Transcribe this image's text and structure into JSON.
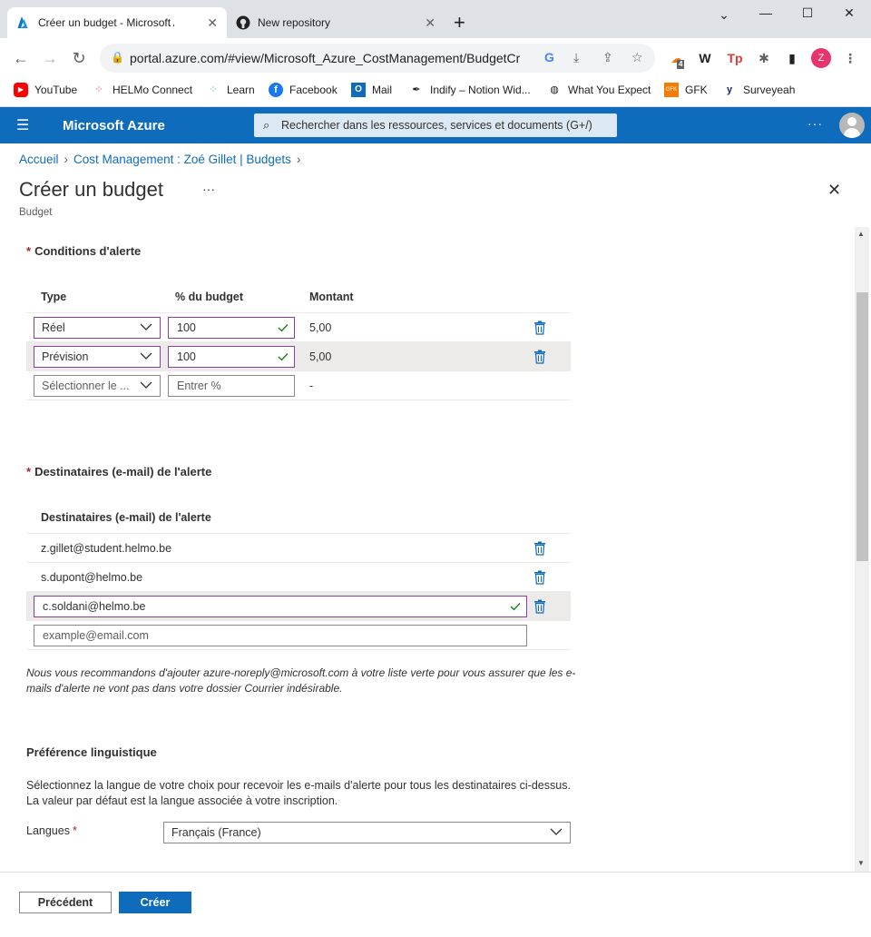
{
  "browser": {
    "tabs": [
      {
        "title": "Créer un budget - Microsoft Azure",
        "active": true
      },
      {
        "title": "New repository",
        "active": false
      }
    ],
    "url": "portal.azure.com/#view/Microsoft_Azure_CostManagement/BudgetCre...",
    "profile_initial": "Z",
    "extension_badge": "4",
    "bookmarks": [
      "YouTube",
      "HELMo Connect",
      "Learn",
      "Facebook",
      "Mail",
      "Indify – Notion Wid...",
      "What You Expect",
      "GFK",
      "Surveyeah"
    ]
  },
  "azure": {
    "brand": "Microsoft Azure",
    "search_placeholder": "Rechercher dans les ressources, services et documents (G+/)",
    "accent": "#0f6cbd"
  },
  "breadcrumb": [
    "Accueil",
    "Cost Management : Zoé Gillet | Budgets"
  ],
  "page": {
    "title": "Créer un budget",
    "subtitle": "Budget"
  },
  "alert_conditions": {
    "title": "Conditions d'alerte",
    "required_mark": "*",
    "columns": [
      "Type",
      "% du budget",
      "Montant"
    ],
    "rows": [
      {
        "type": "Réel",
        "percent": "100",
        "amount": "5,00"
      },
      {
        "type": "Prévision",
        "percent": "100",
        "amount": "5,00"
      }
    ],
    "new_row": {
      "type_placeholder": "Sélectionner le ...",
      "percent_placeholder": "Entrer %",
      "amount": "-"
    }
  },
  "recipients": {
    "title": "Destinataires (e-mail) de l'alerte",
    "required_mark": "*",
    "column": "Destinataires (e-mail) de l'alerte",
    "emails": [
      "z.gillet@student.helmo.be",
      "s.dupont@helmo.be"
    ],
    "editing_email": "c.soldani@helmo.be",
    "placeholder": "example@email.com",
    "note": "Nous vous recommandons d'ajouter azure-noreply@microsoft.com à votre liste verte pour vous assurer que les e-mails d'alerte ne vont pas dans votre dossier Courrier indésirable."
  },
  "language": {
    "title": "Préférence linguistique",
    "description": "Sélectionnez la langue de votre choix pour recevoir les e-mails d'alerte pour tous les destinataires ci-dessus. La valeur par défaut est la langue associée à votre inscription.",
    "label": "Langues",
    "required_mark": "*",
    "selected": "Français (France)"
  },
  "footer": {
    "previous": "Précédent",
    "create": "Créer"
  }
}
